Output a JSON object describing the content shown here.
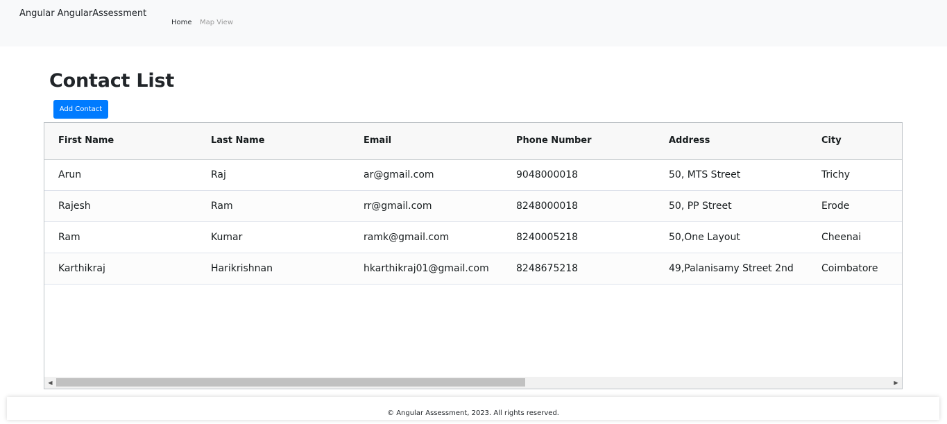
{
  "navbar": {
    "brand": "Angular AngularAssessment",
    "links": [
      "Home",
      "Map View"
    ]
  },
  "page": {
    "title": "Contact List",
    "add_button": "Add Contact"
  },
  "table": {
    "columns": [
      "First Name",
      "Last Name",
      "Email",
      "Phone Number",
      "Address",
      "City"
    ],
    "rows": [
      [
        "Arun",
        "Raj",
        "ar@gmail.com",
        "9048000018",
        "50, MTS Street",
        "Trichy"
      ],
      [
        "Rajesh",
        "Ram",
        "rr@gmail.com",
        "8248000018",
        "50, PP Street",
        "Erode"
      ],
      [
        "Ram",
        "Kumar",
        "ramk@gmail.com",
        "8240005218",
        "50,One Layout",
        "Cheenai"
      ],
      [
        "Karthikraj",
        "Harikrishnan",
        "hkarthikraj01@gmail.com",
        "8248675218",
        "49,Palanisamy Street 2nd",
        "Coimbatore"
      ]
    ]
  },
  "footer": {
    "text": "© Angular Assessment, 2023. All rights reserved."
  },
  "colors": {
    "primary": "#007bff",
    "navbar_bg": "#f8f9fa",
    "header_bg": "#f8f8f8"
  }
}
